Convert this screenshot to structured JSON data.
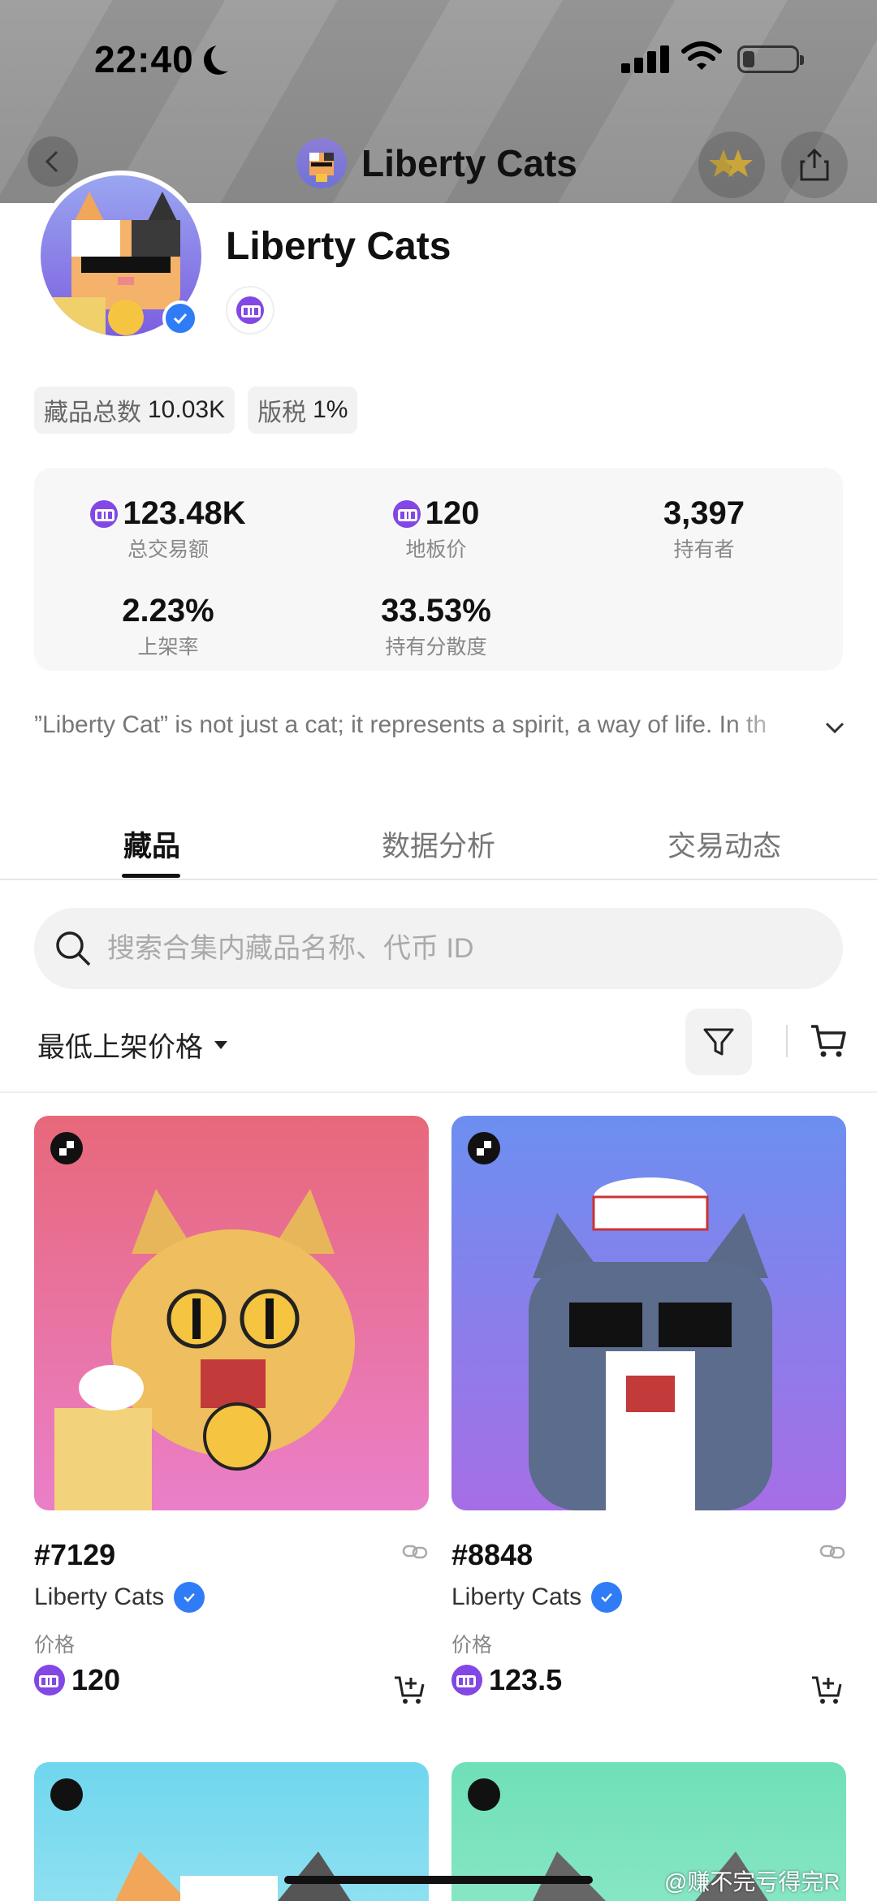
{
  "status_bar": {
    "time": "22:40"
  },
  "nav": {
    "title": "Liberty Cats"
  },
  "profile": {
    "name": "Liberty Cats"
  },
  "chips": [
    {
      "label": "藏品总数",
      "value": "10.03K"
    },
    {
      "label": "版税",
      "value": "1%"
    }
  ],
  "stats": [
    {
      "value": "123.48K",
      "label": "总交易额",
      "currency": true
    },
    {
      "value": "120",
      "label": "地板价",
      "currency": true
    },
    {
      "value": "3,397",
      "label": "持有者",
      "currency": false
    },
    {
      "value": "2.23%",
      "label": "上架率",
      "currency": false
    },
    {
      "value": "33.53%",
      "label": "持有分散度",
      "currency": false
    }
  ],
  "description": "”Liberty Cat” is not just a cat; it represents a spirit, a way of life. In th",
  "tabs": [
    {
      "label": "藏品",
      "active": true
    },
    {
      "label": "数据分析",
      "active": false
    },
    {
      "label": "交易动态",
      "active": false
    }
  ],
  "search": {
    "placeholder": "搜索合集内藏品名称、代币 ID"
  },
  "sort": {
    "label": "最低上架价格"
  },
  "cards": [
    {
      "token_id": "#7129",
      "collection": "Liberty Cats",
      "price_label": "价格",
      "price": "120",
      "bg": "#e8687a"
    },
    {
      "token_id": "#8848",
      "collection": "Liberty Cats",
      "price_label": "价格",
      "price": "123.5",
      "bg": "#7a6fe0"
    }
  ],
  "watermark": "@赚不完亏得完R",
  "colors": {
    "accent": "#8247e5",
    "verified": "#2f7cf6"
  }
}
